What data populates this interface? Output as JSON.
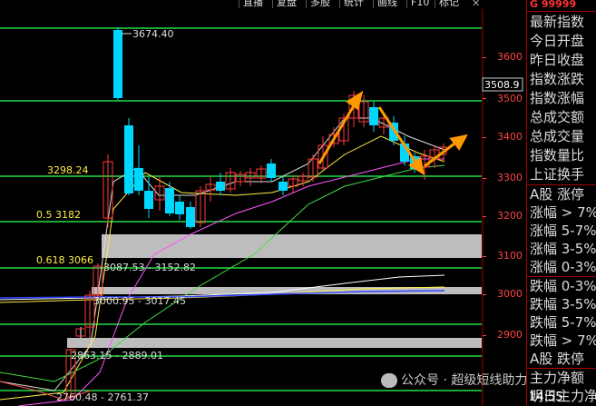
{
  "toolbar": {
    "items": [
      "直播",
      "复盘",
      "多股",
      "统计",
      "画线",
      "F10",
      "标记"
    ],
    "close_glyph": "✕"
  },
  "chart": {
    "price_axis": [
      "3600",
      "3500",
      "3400",
      "3300",
      "3200",
      "3100",
      "3000",
      "2900"
    ],
    "current_price": "3508.9",
    "annotations": {
      "high": "3674.40",
      "level_3298": "3298.24",
      "fib_05": "0.5 3182",
      "fib_0618": "0.618 3066",
      "gap1": "3087.53 - 3152.82",
      "gap2": "3000.95 - 3017.45",
      "gap3": "2863.15 - 2889.01",
      "low": "2760.48 - 2761.37"
    },
    "colors": {
      "up": "#ff3b3b",
      "down": "#00d7ff",
      "level_line": "#22dd44",
      "arrow": "#ff9900"
    }
  },
  "right_panel": {
    "head": "G  99999",
    "rows": [
      "最新指数",
      "今日开盘",
      "昨日收盘",
      "指数涨跌",
      "指数涨幅",
      "总成交额",
      "总成交量",
      "指数量比",
      "上证换手"
    ],
    "group_up_title": "A股 涨停",
    "up_rows": [
      "涨幅 > 7%",
      "涨幅 5-7%",
      "涨幅 3-5%",
      "涨幅 0-3%"
    ],
    "down_rows": [
      "跌幅 0-3%",
      "跌幅 3-5%",
      "跌幅 5-7%",
      "跌幅 > 7%"
    ],
    "group_down_title": "A股 跌停",
    "net_flow": "主力净额",
    "net_flow2": "明日主力净"
  },
  "watermark": "公众号 · 超级短线助力",
  "clock": "14:55"
}
